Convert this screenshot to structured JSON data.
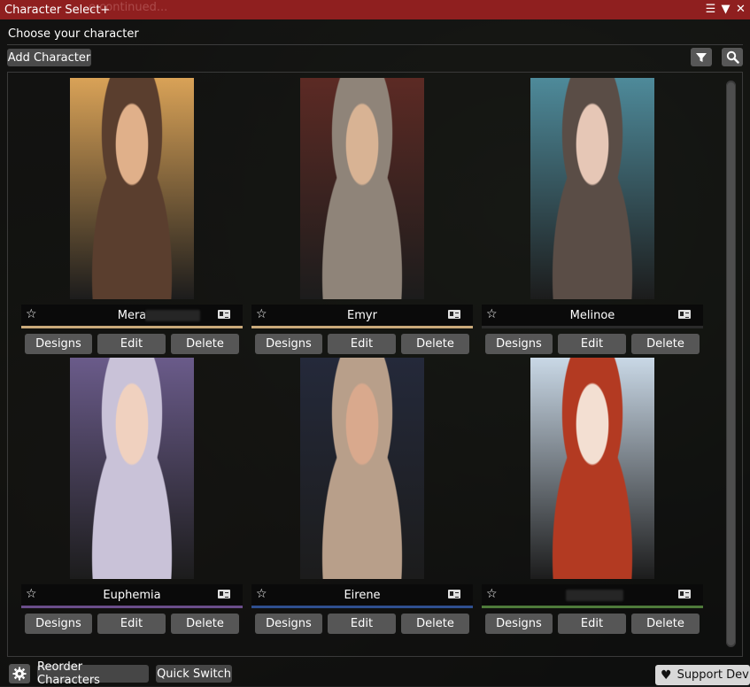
{
  "window": {
    "title": "Character Select+",
    "ghost_text": "e continued...",
    "title_icons": [
      "menu-icon",
      "collapse-icon",
      "close-icon"
    ]
  },
  "header": {
    "subtitle": "Choose your character",
    "add_label": "Add Character"
  },
  "characters": [
    {
      "name": "Mera",
      "accent": "#c9a97a",
      "skin": "#e0b08a",
      "hair": "#5a3e2e",
      "bg": "#d9a257"
    },
    {
      "name": "Emyr",
      "accent": "#c9a97a",
      "skin": "#d8b394",
      "hair": "#8f8479",
      "bg": "#5c2a24"
    },
    {
      "name": "Melinoe",
      "accent": "#2a2a2a",
      "skin": "#e6c7b6",
      "hair": "#5a4d46",
      "bg": "#4e8a9a"
    },
    {
      "name": "Euphemia",
      "accent": "#6a4d8a",
      "skin": "#f0d1bf",
      "hair": "#c9c2d8",
      "bg": "#6a5b8a"
    },
    {
      "name": "Eirene",
      "accent": "#2f4f8f",
      "skin": "#d9a98d",
      "hair": "#b89f8a",
      "bg": "#24293a"
    },
    {
      "name": "",
      "accent": "#4e7a3a",
      "skin": "#f3dfd2",
      "hair": "#b33a22",
      "bg": "#c9d8e6"
    }
  ],
  "card_buttons": {
    "designs": "Designs",
    "edit": "Edit",
    "delete": "Delete"
  },
  "footer": {
    "reorder_label": "Reorder Characters",
    "quick_label": "Quick Switch",
    "support_label": "Support Dev"
  },
  "colors": {
    "titlebar": "#8f1f1f",
    "button": "#565656"
  }
}
